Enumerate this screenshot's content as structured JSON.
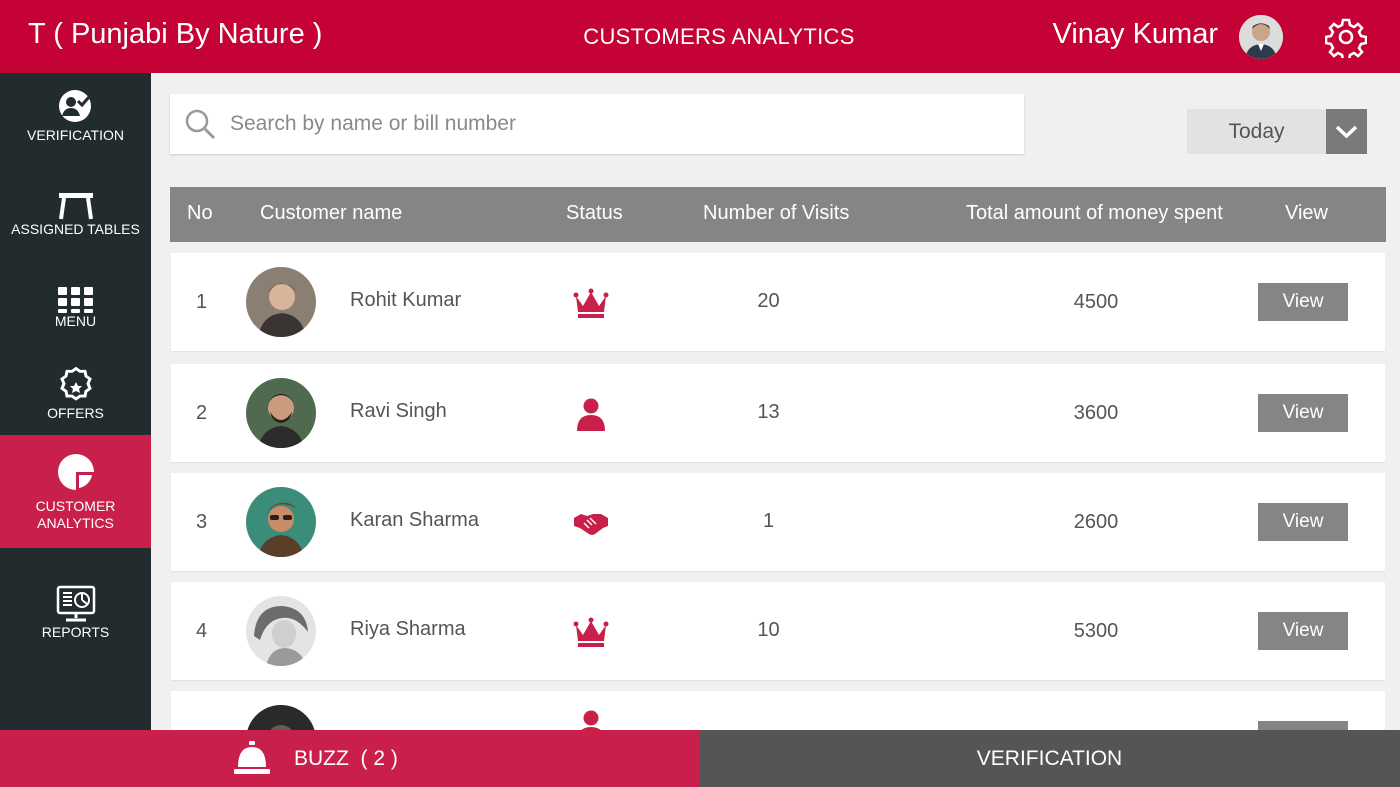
{
  "header": {
    "brand": "T ( Punjabi By Nature )",
    "title": "CUSTOMERS ANALYTICS",
    "user_name": "Vinay Kumar"
  },
  "sidebar": {
    "items": [
      {
        "label": "VERIFICATION",
        "icon": "verification-icon"
      },
      {
        "label": "ASSIGNED TABLES",
        "icon": "table-icon"
      },
      {
        "label": "MENU",
        "icon": "grid-icon"
      },
      {
        "label": "OFFERS",
        "icon": "offer-badge-icon"
      },
      {
        "label": "CUSTOMER",
        "label2": "ANALYTICS",
        "icon": "pie-chart-icon",
        "active": true
      },
      {
        "label": "REPORTS",
        "icon": "reports-monitor-icon"
      }
    ]
  },
  "search": {
    "placeholder": "Search by name or bill number",
    "value": ""
  },
  "filter": {
    "selected": "Today"
  },
  "table": {
    "columns": [
      "No",
      "Customer name",
      "Status",
      "Number of Visits",
      "Total amount of money spent",
      "View"
    ],
    "rows": [
      {
        "no": "1",
        "name": "Rohit Kumar",
        "status": "crown-icon",
        "visits": "20",
        "amount": "4500",
        "action": "View"
      },
      {
        "no": "2",
        "name": "Ravi Singh",
        "status": "person-icon",
        "visits": "13",
        "amount": "3600",
        "action": "View"
      },
      {
        "no": "3",
        "name": "Karan Sharma",
        "status": "handshake-icon",
        "visits": "1",
        "amount": "2600",
        "action": "View"
      },
      {
        "no": "4",
        "name": "Riya Sharma",
        "status": "crown-icon",
        "visits": "10",
        "amount": "5300",
        "action": "View"
      }
    ]
  },
  "bottom": {
    "buzz_label": "BUZZ",
    "buzz_count": "( 2 )",
    "verification_label": "VERIFICATION"
  },
  "colors": {
    "primary": "#c40235",
    "accent": "#c8204b",
    "sidebar": "#222b2e",
    "header_row": "#858585"
  }
}
